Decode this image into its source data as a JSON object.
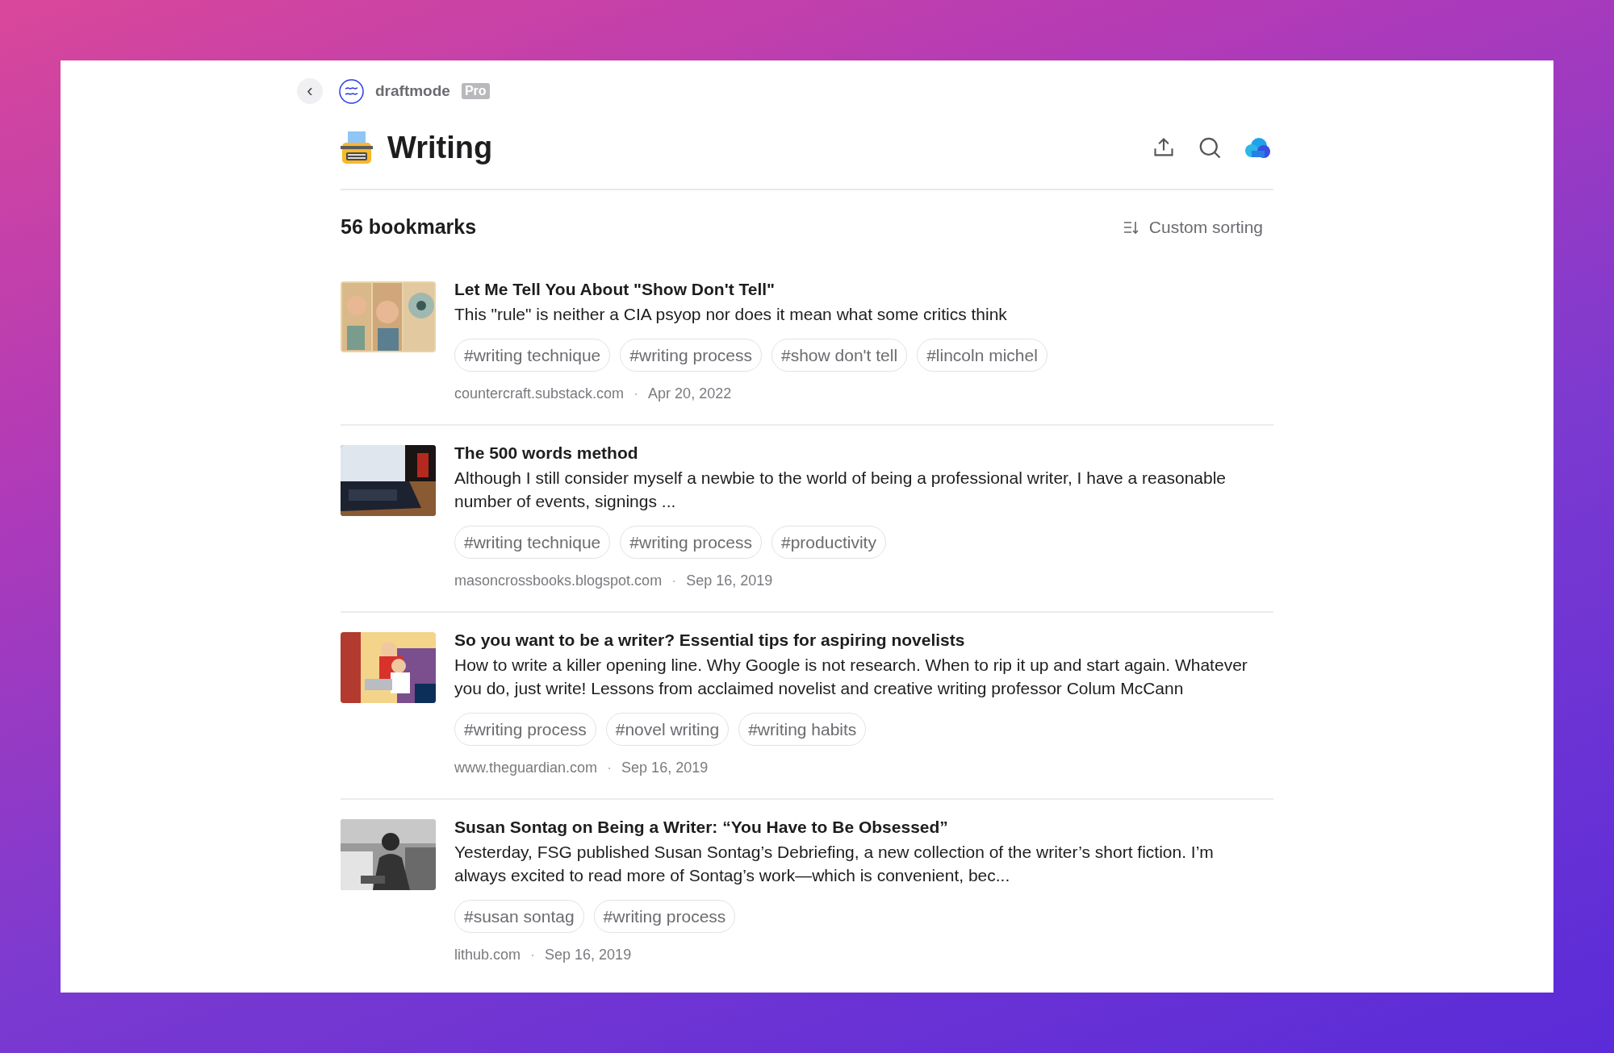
{
  "header": {
    "back_label": "‹",
    "app_name": "draftmode",
    "badge": "Pro"
  },
  "collection": {
    "title": "Writing"
  },
  "list_header": {
    "count": "56 bookmarks",
    "sorting": "Custom sorting"
  },
  "bookmarks": [
    {
      "thumb": {
        "kind": "picture"
      },
      "title": "Let Me Tell You About \"Show Don't Tell\"",
      "description": "This \"rule\" is neither a CIA psyop nor does it mean what some critics think",
      "tags": [
        "#writing technique",
        "#writing process",
        "#show don't tell",
        "#lincoln michel"
      ],
      "site": "countercraft.substack.com",
      "separator": "·",
      "date": "Apr 20, 2022"
    },
    {
      "thumb": {
        "kind": "picture"
      },
      "title": "The 500 words method",
      "description": "Although I still consider myself a newbie to the world of being a professional writer, I have a reasonable number of events, signings ...",
      "tags": [
        "#writing technique",
        "#writing process",
        "#productivity"
      ],
      "site": "masoncrossbooks.blogspot.com",
      "separator": "·",
      "date": "Sep 16, 2019"
    },
    {
      "thumb": {
        "kind": "picture"
      },
      "title": "So you want to be a writer? Essential tips for aspiring novelists",
      "description": "How to write a killer opening line. Why Google is not research. When to rip it up and start again. Whatever you do, just write! Lessons from acclaimed novelist and creative writing professor Colum McCann",
      "tags": [
        "#writing process",
        "#novel writing",
        "#writing habits"
      ],
      "site": "www.theguardian.com",
      "separator": "·",
      "date": "Sep 16, 2019"
    },
    {
      "thumb": {
        "kind": "picture"
      },
      "title": "Susan Sontag on Being a Writer: “You Have to Be Obsessed”",
      "description": "Yesterday, FSG published Susan Sontag’s Debriefing, a new collection of the writer’s short fiction. I’m always excited to read more of Sontag’s work—which is convenient, bec...",
      "tags": [
        "#susan sontag",
        "#writing process"
      ],
      "site": "lithub.com",
      "separator": "·",
      "date": "Sep 16, 2019"
    }
  ]
}
